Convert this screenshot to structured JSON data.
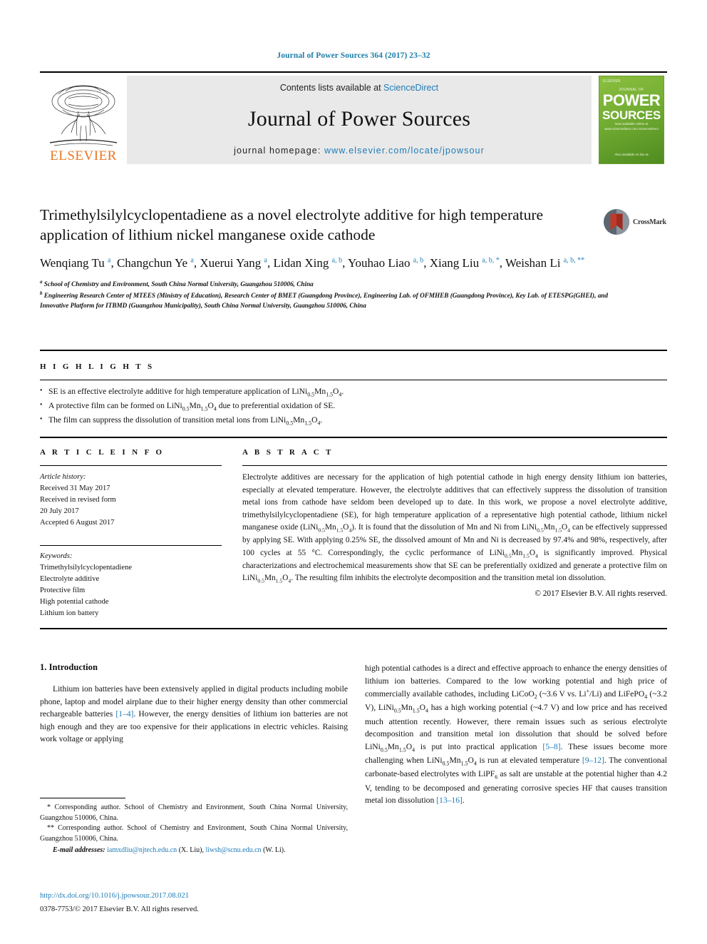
{
  "running_head": "Journal of Power Sources 364 (2017) 23–32",
  "masthead": {
    "publisher": "ELSEVIER",
    "contents_prefix": "Contents lists available at ",
    "contents_link": "ScienceDirect",
    "journal_title": "Journal of Power Sources",
    "homepage_prefix": "journal homepage: ",
    "homepage_url": "www.elsevier.com/locate/jpowsour",
    "cover": {
      "publisher_mark": "ELSEVIER",
      "eyebrow": "JOURNAL OF",
      "line1": "POWER",
      "line2": "SOURCES",
      "subtitle": "Now available online at\nwww.sciencedirect.com  ScienceDirect",
      "footer": "Also available\non line at"
    }
  },
  "article": {
    "title": "Trimethylsilylcyclopentadiene as a novel electrolyte additive for high temperature application of lithium nickel manganese oxide cathode",
    "crossmark_label": "CrossMark",
    "authors_html": "Wenqiang Tu <sup>a</sup>, Changchun Ye <sup>a</sup>, Xuerui Yang <sup>a</sup>, Lidan Xing <sup>a, b</sup>, Youhao Liao <sup>a, b</sup>, Xiang Liu <sup>a, b, *</sup>, Weishan Li <sup>a, b, **</sup>",
    "affiliations": [
      {
        "mark": "a",
        "text": "School of Chemistry and Environment, South China Normal University, Guangzhou 510006, China"
      },
      {
        "mark": "b",
        "text": "Engineering Research Center of MTEES (Ministry of Education), Research Center of BMET (Guangdong Province), Engineering Lab. of OFMHEB (Guangdong Province), Key Lab. of ETESPG(GHEI), and Innovative Platform for ITBMD (Guangzhou Municipality), South China Normal University, Guangzhou 510006, China"
      }
    ]
  },
  "highlights": {
    "label": "H I G H L I G H T S",
    "items_html": [
      "SE is an effective electrolyte additive for high temperature application of LiNi<sub>0.5</sub>Mn<sub>1.5</sub>O<sub>4</sub>.",
      "A protective film can be formed on LiNi<sub>0.5</sub>Mn<sub>1.5</sub>O<sub>4</sub> due to preferential oxidation of SE.",
      "The film can suppress the dissolution of transition metal ions from LiNi<sub>0.5</sub>Mn<sub>1.5</sub>O<sub>4</sub>."
    ]
  },
  "article_info": {
    "label": "A R T I C L E  I N F O",
    "history_label": "Article history:",
    "history": [
      "Received 31 May 2017",
      "Received in revised form",
      "20 July 2017",
      "Accepted 6 August 2017"
    ],
    "keywords_label": "Keywords:",
    "keywords": [
      "Trimethylsilylcyclopentadiene",
      "Electrolyte additive",
      "Protective film",
      "High potential cathode",
      "Lithium ion battery"
    ]
  },
  "abstract": {
    "label": "A B S T R A C T",
    "text_html": "Electrolyte additives are necessary for the application of high potential cathode in high energy density lithium ion batteries, especially at elevated temperature. However, the electrolyte additives that can effectively suppress the dissolution of transition metal ions from cathode have seldom been developed up to date. In this work, we propose a novel electrolyte additive, trimethylsilylcyclopentadiene (SE), for high temperature application of a representative high potential cathode, lithium nickel manganese oxide (LiNi<sub>0.5</sub>Mn<sub>1.5</sub>O<sub>4</sub>). It is found that the dissolution of Mn and Ni from LiNi<sub>0.5</sub>Mn<sub>1.5</sub>O<sub>4</sub> can be effectively suppressed by applying SE. With applying 0.25% SE, the dissolved amount of Mn and Ni is decreased by 97.4% and 98%, respectively, after 100 cycles at 55 °C. Correspondingly, the cyclic performance of LiNi<sub>0.5</sub>Mn<sub>1.5</sub>O<sub>4</sub> is significantly improved. Physical characterizations and electrochemical measurements show that SE can be preferentially oxidized and generate a protective film on LiNi<sub>0.5</sub>Mn<sub>1.5</sub>O<sub>4</sub>. The resulting film inhibits the electrolyte decomposition and the transition metal ion dissolution.",
    "copyright": "© 2017 Elsevier B.V. All rights reserved."
  },
  "body": {
    "section_heading": "1. Introduction",
    "left_paragraph_html": "Lithium ion batteries have been extensively applied in digital products including mobile phone, laptop and model airplane due to their higher energy density than other commercial rechargeable batteries <span class=\"ref\">[1–4]</span>. However, the energy densities of lithium ion batteries are not high enough and they are too expensive for their applications in electric vehicles. Raising work voltage or applying",
    "right_paragraph_html": "high potential cathodes is a direct and effective approach to enhance the energy densities of lithium ion batteries. Compared to the low working potential and high price of commercially available cathodes, including LiCoO<sub>2</sub> (~3.6 V vs. Li<sup>+</sup>/Li) and LiFePO<sub>4</sub> (~3.2 V), LiNi<sub>0.5</sub>Mn<sub>1.5</sub>O<sub>4</sub> has a high working potential (~4.7 V) and low price and has received much attention recently. However, there remain issues such as serious electrolyte decomposition and transition metal ion dissolution that should be solved before LiNi<sub>0.5</sub>Mn<sub>1.5</sub>O<sub>4</sub> is put into practical application <span class=\"ref\">[5–8]</span>. These issues become more challenging when LiNi<sub>0.5</sub>Mn<sub>1.5</sub>O<sub>4</sub> is run at elevated temperature <span class=\"ref\">[9–12]</span>. The conventional carbonate-based electrolytes with LiPF<sub>6</sub> as salt are unstable at the potential higher than 4.2 V, tending to be decomposed and generating corrosive species HF that causes transition metal ion dissolution <span class=\"ref\">[13–16]</span>."
  },
  "footnotes": {
    "corresponding_1": "* Corresponding author. School of Chemistry and Environment, South China Normal University, Guangzhou 510006, China.",
    "corresponding_2": "** Corresponding author. School of Chemistry and Environment, South China Normal University, Guangzhou 510006, China.",
    "email_label": "E-mail addresses:",
    "email_1": "iamxdliu@njtech.edu.cn",
    "email_1_name": "(X. Liu),",
    "email_2": "liwsh@scnu.edu.cn",
    "email_2_name": "(W. Li)."
  },
  "doi": {
    "url": "http://dx.doi.org/10.1016/j.jpowsour.2017.08.021",
    "issn_line": "0378-7753/© 2017 Elsevier B.V. All rights reserved."
  },
  "colors": {
    "link": "#1f7bb6",
    "elsevier_orange": "#E87722",
    "cover_green": "#76b035"
  }
}
